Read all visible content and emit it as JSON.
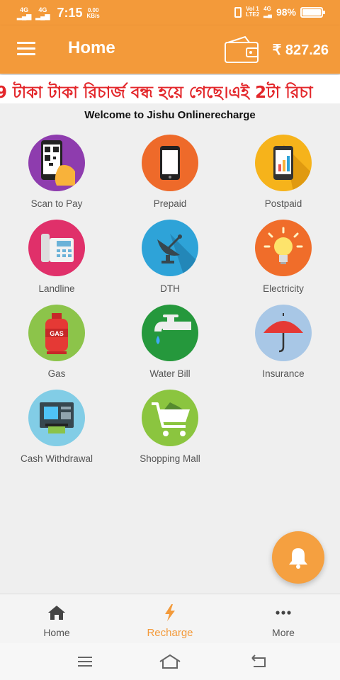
{
  "status_bar": {
    "signal1": "4G",
    "signal2": "4G",
    "time": "7:15",
    "speed_value": "0.00",
    "speed_unit": "KB/s",
    "volte": "Vol 1",
    "lte": "LTE2",
    "net_type": "4G",
    "battery": "98%"
  },
  "app_bar": {
    "title": "Home",
    "balance": "₹ 827.26",
    "menu_icon": "hamburger-menu-icon",
    "wallet_icon": "wallet-icon"
  },
  "marquee": {
    "text": "9 টাকা টাকা রিচার্জ বন্ধ হয়ে গেছে।এই 2টা রিচা"
  },
  "welcome": "Welcome to Jishu Onlinerecharge",
  "services": [
    {
      "label": "Scan to Pay",
      "icon": "qr-scan-icon",
      "color": "#8e3cae"
    },
    {
      "label": "Prepaid",
      "icon": "mobile-phone-icon",
      "color": "#ee6a2a"
    },
    {
      "label": "Postpaid",
      "icon": "postpaid-phone-icon",
      "color": "#f6b31b"
    },
    {
      "label": "Landline",
      "icon": "landline-phone-icon",
      "color": "#e0306a"
    },
    {
      "label": "DTH",
      "icon": "satellite-dish-icon",
      "color": "#2ea3d8"
    },
    {
      "label": "Electricity",
      "icon": "light-bulb-icon",
      "color": "#f06d2a"
    },
    {
      "label": "Gas",
      "icon": "gas-cylinder-icon",
      "color": "#8cc44a"
    },
    {
      "label": "Water Bill",
      "icon": "water-tap-icon",
      "color": "#25983c"
    },
    {
      "label": "Insurance",
      "icon": "umbrella-icon",
      "color": "#a8c7e6"
    },
    {
      "label": "Cash Withdrawal",
      "icon": "atm-icon",
      "color": "#82cde6"
    },
    {
      "label": "Shopping Mall",
      "icon": "shopping-cart-icon",
      "color": "#8bc53f"
    }
  ],
  "fab": {
    "icon": "bell-icon"
  },
  "bottom_nav": [
    {
      "label": "Home",
      "icon": "home-icon",
      "active": false
    },
    {
      "label": "Recharge",
      "icon": "lightning-bolt-icon",
      "active": true
    },
    {
      "label": "More",
      "icon": "more-dots-icon",
      "active": false
    }
  ],
  "colors": {
    "primary": "#f39a3a",
    "marquee_text": "#e3272b",
    "background": "#efefef"
  }
}
